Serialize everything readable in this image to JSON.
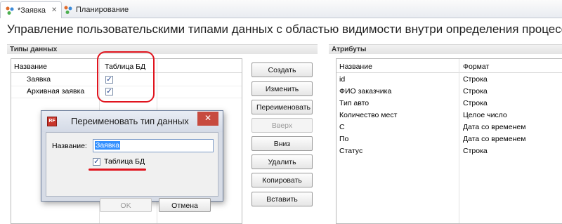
{
  "tabs": [
    {
      "label": "*Заявка",
      "active": true,
      "icon": "process-icon",
      "closable": true
    },
    {
      "label": "Планирование",
      "active": false,
      "icon": "process-icon",
      "closable": false
    }
  ],
  "page_title": "Управление пользовательскими типами данных с областью видимости внутри определения процесса",
  "data_types": {
    "section_title": "Типы данных",
    "columns": [
      "Название",
      "Таблица БД"
    ],
    "rows": [
      {
        "name": "Заявка",
        "db_table": true
      },
      {
        "name": "Архивная заявка",
        "db_table": true
      }
    ]
  },
  "buttons": {
    "create": "Создать",
    "edit": "Изменить",
    "rename": "Переименовать",
    "up": "Вверх",
    "down": "Вниз",
    "delete": "Удалить",
    "copy": "Копировать",
    "paste": "Вставить"
  },
  "attributes": {
    "section_title": "Атрибуты",
    "columns": [
      "Название",
      "Формат"
    ],
    "rows": [
      {
        "name": "id",
        "format": "Строка"
      },
      {
        "name": "ФИО заказчика",
        "format": "Строка"
      },
      {
        "name": "Тип авто",
        "format": "Строка"
      },
      {
        "name": "Количество мест",
        "format": "Целое число"
      },
      {
        "name": "С",
        "format": "Дата со временем"
      },
      {
        "name": "По",
        "format": "Дата со временем"
      },
      {
        "name": "Статус",
        "format": "Строка"
      }
    ]
  },
  "rename_dialog": {
    "title": "Переименовать тип данных",
    "name_label": "Название:",
    "name_value": "Заявка",
    "db_table_label": "Таблица БД",
    "db_table_checked": true,
    "ok_label": "OK",
    "cancel_label": "Отмена",
    "close_symbol": "✕"
  },
  "colors": {
    "annotation": "#e0141e",
    "selection": "#3390ff"
  }
}
